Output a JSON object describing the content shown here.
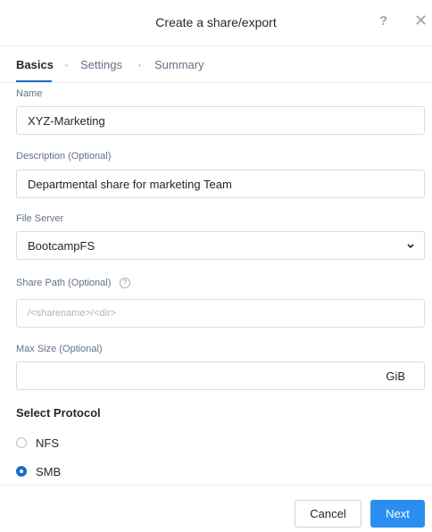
{
  "dialog": {
    "title": "Create a share/export",
    "help_icon": "question-mark-icon",
    "help_label": "?",
    "close_icon": "close-icon",
    "close_label": "✕"
  },
  "tabs": [
    {
      "label": "Basics",
      "active": true
    },
    {
      "label": "Settings",
      "active": false
    },
    {
      "label": "Summary",
      "active": false
    }
  ],
  "form": {
    "name": {
      "label": "Name",
      "value": "XYZ-Marketing"
    },
    "description": {
      "label": "Description (Optional)",
      "value": "Departmental share for marketing Team"
    },
    "file_server": {
      "label": "File Server",
      "selected": "BootcampFS",
      "icon": "chevron-down-icon"
    },
    "share_path": {
      "label": "Share Path (Optional)",
      "placeholder": "/<sharename>/<dir>",
      "info_icon": "info-icon",
      "info_label": "?"
    },
    "max_size": {
      "label": "Max Size (Optional)",
      "value": "",
      "unit": "GiB"
    }
  },
  "protocol": {
    "title": "Select Protocol",
    "options": [
      {
        "label": "NFS",
        "selected": false
      },
      {
        "label": "SMB",
        "selected": true
      }
    ]
  },
  "footer": {
    "cancel_label": "Cancel",
    "next_label": "Next"
  },
  "colors": {
    "accent": "#2a8ef0",
    "tab_underline": "#1b6dc6",
    "border": "#d7dde3",
    "muted_text": "#627386"
  }
}
